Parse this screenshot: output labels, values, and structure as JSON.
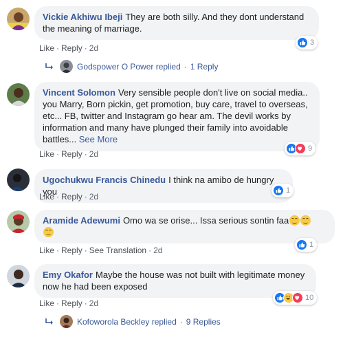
{
  "colors": {
    "link": "#385898",
    "bubble": "#f2f3f5",
    "like_blue": "#1877f2",
    "love_red": "#f33e58",
    "haha_yellow": "#f7c948"
  },
  "actions": {
    "like": "Like",
    "reply": "Reply",
    "see_translation": "See Translation",
    "sep": "·"
  },
  "comments": [
    {
      "author": "Vickie Akhiwu Ibeji",
      "text": "They are both silly. And they dont understand the meaning of marriage.",
      "time": "2d",
      "reactions": {
        "icons": [
          "like-icon"
        ],
        "count": "3"
      },
      "replies": {
        "name": "Godspower O Power replied",
        "dot": "·",
        "count": "1 Reply"
      }
    },
    {
      "author": "Vincent Solomon",
      "text": "Very sensible people don't live on social media.. you Marry, Born pickin, get promotion, buy care, travel to overseas, etc... FB, twitter and Instagram go hear am. The devil works by information and many have plunged their family into avoidable battles...",
      "see_more": "See More",
      "time": "2d",
      "reactions": {
        "icons": [
          "like-icon",
          "love-icon"
        ],
        "count": "9"
      }
    },
    {
      "author": "Ugochukwu Francis Chinedu",
      "text": "I think na amibo de hungry you",
      "time": "2d",
      "reactions": {
        "icons": [
          "like-icon"
        ],
        "count": "1"
      }
    },
    {
      "author": "Aramide Adewumi",
      "text": "Omo wa se orise... Issa serious sontin faa",
      "emojis": [
        "grimacing-face-icon",
        "grimacing-face-icon",
        "grimacing-face-icon"
      ],
      "time": "2d",
      "reactions": {
        "icons": [
          "like-icon"
        ],
        "count": "1"
      }
    },
    {
      "author": "Emy Okafor",
      "text": "Maybe the house was not built with legitimate money now he had been exposed",
      "time": "2d",
      "reactions": {
        "icons": [
          "like-icon",
          "haha-icon",
          "love-icon"
        ],
        "count": "10"
      },
      "replies": {
        "name": "Kofoworola Beckley replied",
        "dot": "·",
        "count": "9 Replies"
      }
    }
  ]
}
